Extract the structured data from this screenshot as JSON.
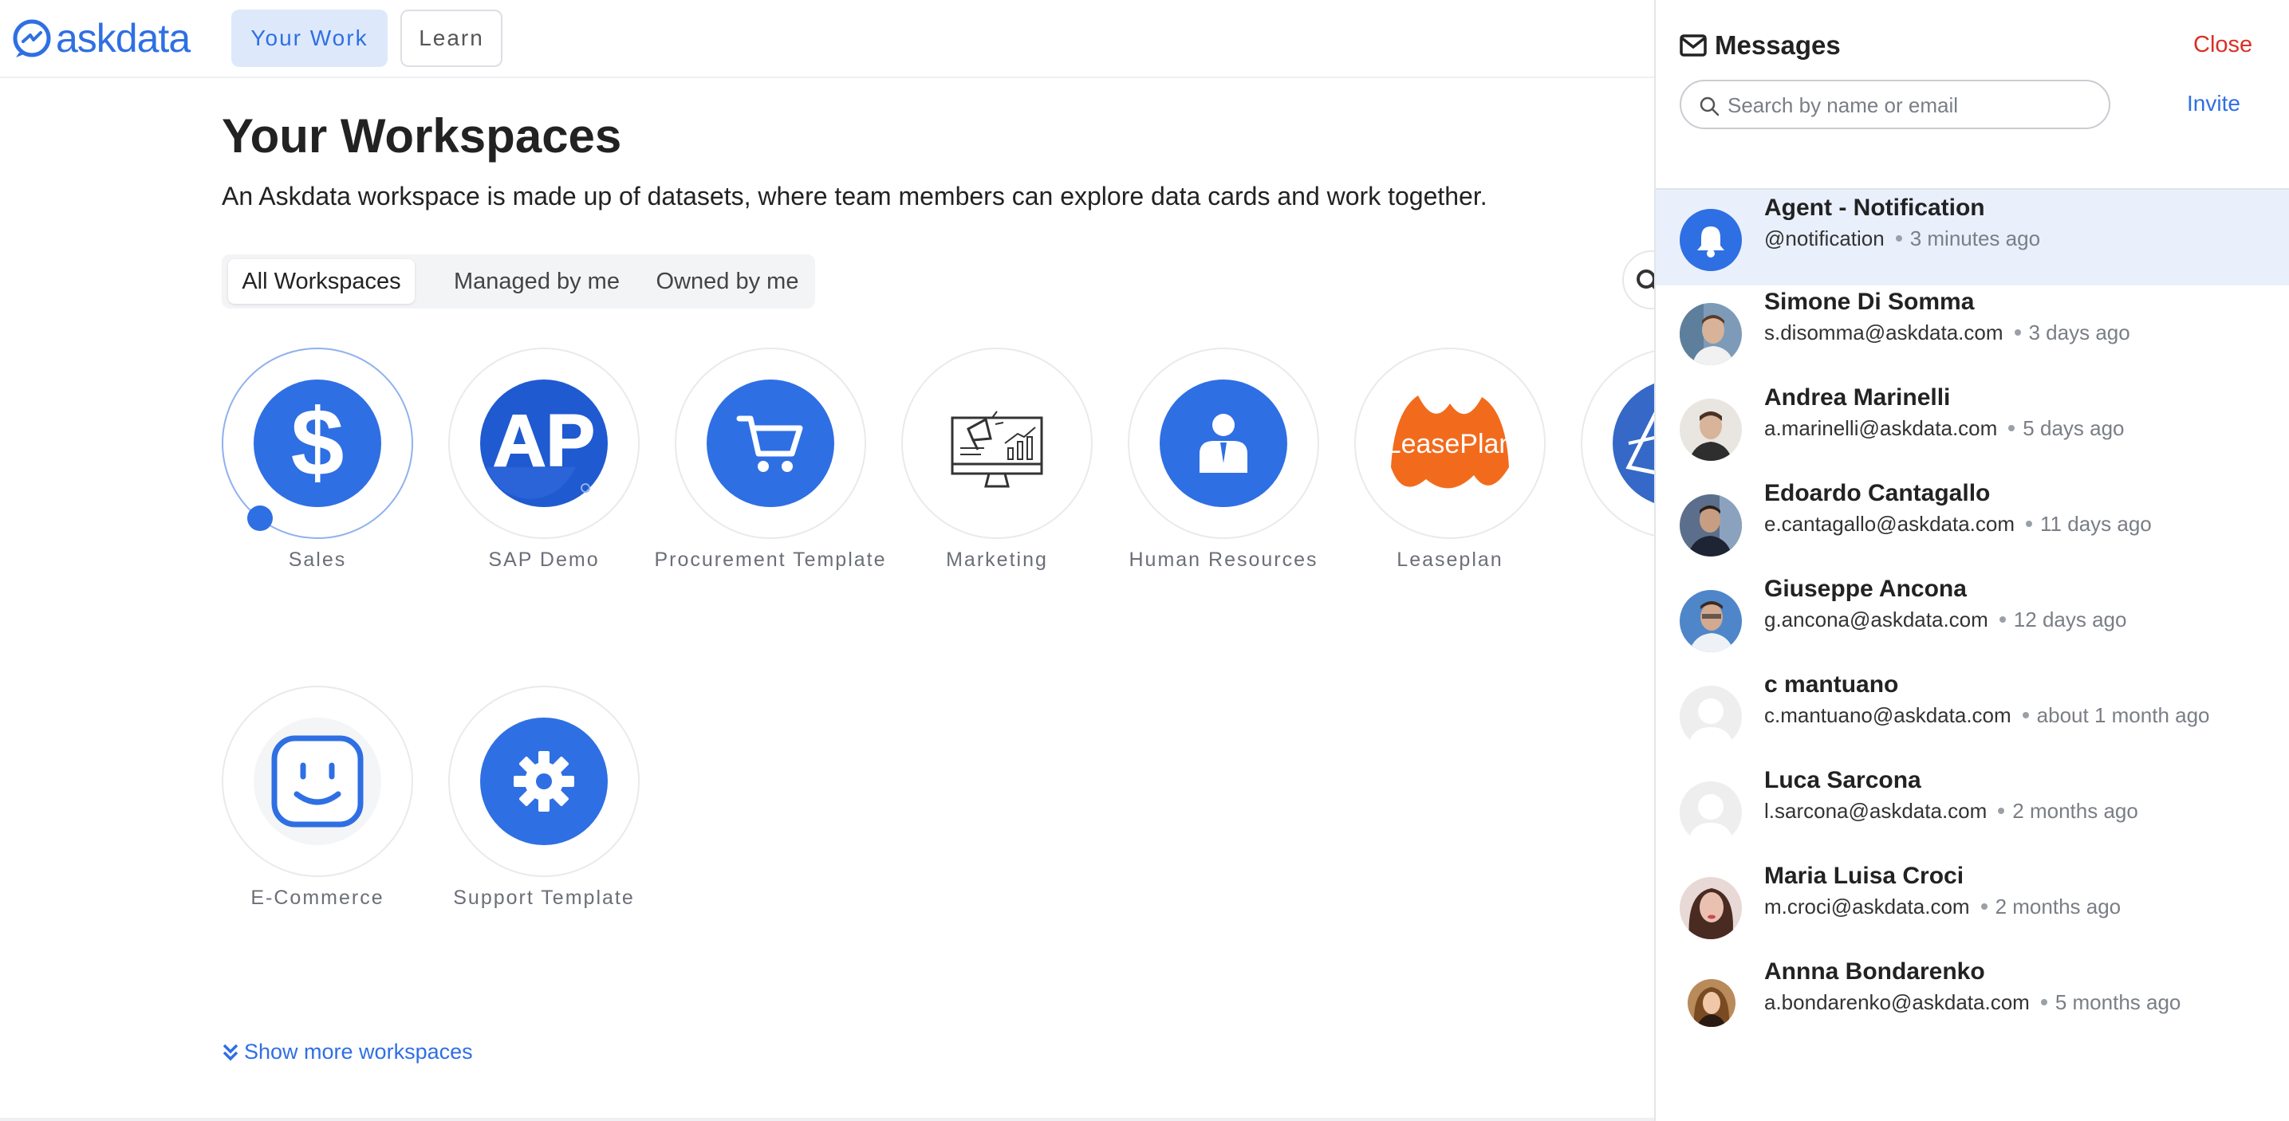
{
  "app": {
    "name": "askdata"
  },
  "nav": {
    "your_work": "Your Work",
    "learn": "Learn"
  },
  "main": {
    "title": "Your Workspaces",
    "subtitle": "An Askdata workspace is made up of datasets, where team members can explore data cards and work together.",
    "filters": [
      "All Workspaces",
      "Managed by me",
      "Owned by me"
    ],
    "selected_filter": "All Workspaces",
    "workspaces": [
      {
        "name": "Sales",
        "icon": "dollar-icon",
        "active": true
      },
      {
        "name": "SAP Demo",
        "icon": "sap-logo"
      },
      {
        "name": "Procurement Template",
        "icon": "shopping-cart-icon"
      },
      {
        "name": "Marketing",
        "icon": "megaphone-monitor-icon"
      },
      {
        "name": "Human Resources",
        "icon": "person-icon"
      },
      {
        "name": "Leaseplan",
        "icon": "leaseplan-logo",
        "logo_text": "LeasePlan"
      },
      {
        "name": "E-Commerce",
        "icon": "smiley-face-icon"
      },
      {
        "name": "Support Template",
        "icon": "gear-icon"
      }
    ],
    "show_more": "Show more workspaces"
  },
  "messages": {
    "title": "Messages",
    "close": "Close",
    "search_placeholder": "Search by name or email",
    "invite": "Invite",
    "contacts": [
      {
        "name": "Agent - Notification",
        "handle": "@notification",
        "time": "3 minutes ago",
        "avatar": "bell-icon",
        "highlighted": true
      },
      {
        "name": "Simone Di Somma",
        "handle": "s.disomma@askdata.com",
        "time": "3 days ago",
        "avatar": "photo"
      },
      {
        "name": "Andrea Marinelli",
        "handle": "a.marinelli@askdata.com",
        "time": "5 days ago",
        "avatar": "photo"
      },
      {
        "name": "Edoardo Cantagallo",
        "handle": "e.cantagallo@askdata.com",
        "time": "11 days ago",
        "avatar": "photo"
      },
      {
        "name": "Giuseppe Ancona",
        "handle": "g.ancona@askdata.com",
        "time": "12 days ago",
        "avatar": "photo"
      },
      {
        "name": "c mantuano",
        "handle": "c.mantuano@askdata.com",
        "time": "about 1 month ago",
        "avatar": "default-avatar-icon"
      },
      {
        "name": "Luca Sarcona",
        "handle": "l.sarcona@askdata.com",
        "time": "2 months ago",
        "avatar": "default-avatar-icon"
      },
      {
        "name": "Maria Luisa Croci",
        "handle": "m.croci@askdata.com",
        "time": "2 months ago",
        "avatar": "photo"
      },
      {
        "name": "Annna Bondarenko",
        "handle": "a.bondarenko@askdata.com",
        "time": "5 months ago",
        "avatar": "photo"
      }
    ]
  },
  "colors": {
    "accent": "#2f6fe4",
    "close": "#d93025",
    "highlight": "#e9f0fc",
    "leaseplan": "#f26b1d"
  }
}
